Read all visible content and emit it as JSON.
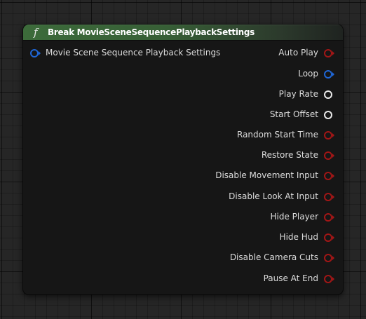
{
  "node": {
    "title": "Break MovieSceneSequencePlaybackSettings",
    "icon": "function-icon",
    "icon_glyph": "f",
    "header_color": "#3c6b3a"
  },
  "input_pin": {
    "label": "Movie Scene Sequence Playback Settings",
    "color": "#1f66d6",
    "has_arrow": true
  },
  "output_pins": [
    {
      "label": "Auto Play",
      "color": "#a11616",
      "has_arrow": true
    },
    {
      "label": "Loop",
      "color": "#1f66d6",
      "has_arrow": true
    },
    {
      "label": "Play Rate",
      "color": "#e8e8e8",
      "has_arrow": false
    },
    {
      "label": "Start Offset",
      "color": "#e8e8e8",
      "has_arrow": false
    },
    {
      "label": "Random Start Time",
      "color": "#a11616",
      "has_arrow": true
    },
    {
      "label": "Restore State",
      "color": "#a11616",
      "has_arrow": true
    },
    {
      "label": "Disable Movement Input",
      "color": "#a11616",
      "has_arrow": true
    },
    {
      "label": "Disable Look At Input",
      "color": "#a11616",
      "has_arrow": true
    },
    {
      "label": "Hide Player",
      "color": "#a11616",
      "has_arrow": true
    },
    {
      "label": "Hide Hud",
      "color": "#a11616",
      "has_arrow": true
    },
    {
      "label": "Disable Camera Cuts",
      "color": "#a11616",
      "has_arrow": true
    },
    {
      "label": "Pause At End",
      "color": "#a11616",
      "has_arrow": true
    }
  ]
}
